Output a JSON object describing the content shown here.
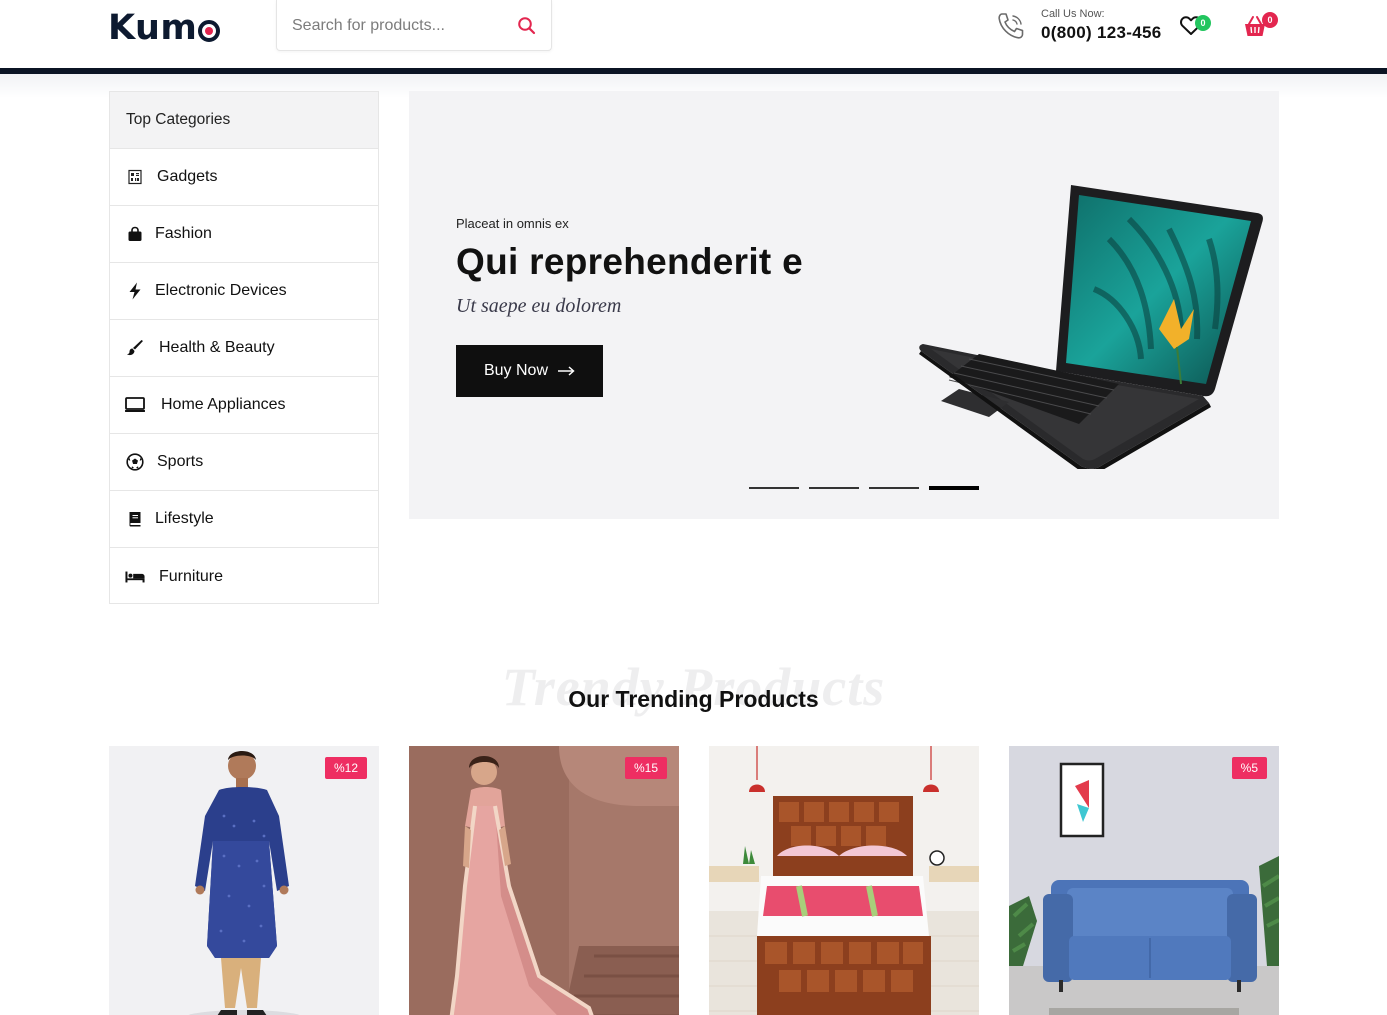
{
  "header": {
    "logo": "Kum",
    "search_placeholder": "Search for products...",
    "call_label": "Call Us Now:",
    "call_number": "0(800) 123-456",
    "wishlist_count": "0",
    "cart_count": "0"
  },
  "sidebar": {
    "title": "Top Categories",
    "items": [
      {
        "label": "Gadgets",
        "icon": "gadget-icon"
      },
      {
        "label": "Fashion",
        "icon": "shopping-bag-icon"
      },
      {
        "label": "Electronic Devices",
        "icon": "bolt-icon"
      },
      {
        "label": "Health & Beauty",
        "icon": "brush-icon"
      },
      {
        "label": "Home Appliances",
        "icon": "monitor-icon"
      },
      {
        "label": "Sports",
        "icon": "soccer-ball-icon"
      },
      {
        "label": "Lifestyle",
        "icon": "book-icon"
      },
      {
        "label": "Furniture",
        "icon": "bed-icon"
      }
    ]
  },
  "hero": {
    "eyebrow": "Placeat in omnis ex",
    "title": "Qui reprehenderit e",
    "subtitle": "Ut saepe eu dolorem",
    "button_label": "Buy Now",
    "slides": 4,
    "active_slide": 4
  },
  "trending": {
    "ghost_title": "Trendy Products",
    "title": "Our Trending Products",
    "products": [
      {
        "image": "men-kurta",
        "discount": "%12"
      },
      {
        "image": "pink-saree",
        "discount": "%15"
      },
      {
        "image": "wooden-bed",
        "discount": ""
      },
      {
        "image": "blue-sofa",
        "discount": "%5"
      }
    ]
  },
  "colors": {
    "brand": "#0d1a30",
    "accent": "#e3264f",
    "badge_green": "#22c55e",
    "discount": "#ee2e62"
  }
}
